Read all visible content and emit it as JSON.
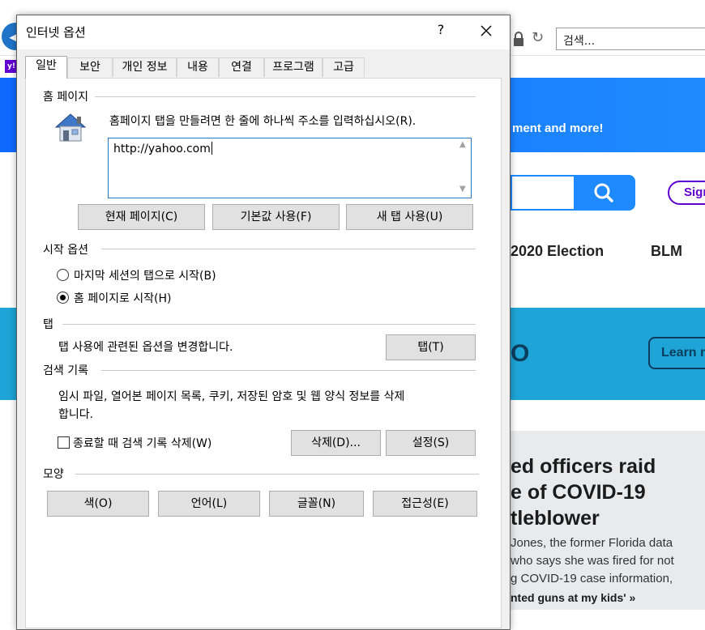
{
  "browser": {
    "search_placeholder": "검색...",
    "yahoo_favicon": "y!",
    "promo_text": "ment and more!",
    "signin_label": "Sign",
    "nav": [
      "2020 Election",
      "BLM"
    ],
    "teal_text": "O",
    "learn_label": "Learn m",
    "headline_lines": [
      "ed officers raid",
      "e of COVID-19",
      "tleblower"
    ],
    "summary_lines": [
      "Jones, the former Florida data",
      "who says she was fired for not",
      "g COVID-19 case information,"
    ],
    "quote": "nted guns at my kids' »",
    "colors": {
      "yahoo_purple": "#6001d2",
      "yahoo_blue": "#1d8bff",
      "teal": "#1ea4d6"
    }
  },
  "dialog": {
    "title": "인터넷 옵션",
    "help_label": "?",
    "tabs": [
      "일반",
      "보안",
      "개인 정보",
      "내용",
      "연결",
      "프로그램",
      "고급"
    ],
    "active_tab": 0,
    "home_page": {
      "label": "홈 페이지",
      "description": "홈페이지 탭을 만들려면 한 줄에 하나씩 주소를 입력하십시오(R).",
      "url_value": "http://yahoo.com",
      "buttons": [
        "현재 페이지(C)",
        "기본값 사용(F)",
        "새 탭 사용(U)"
      ]
    },
    "startup": {
      "label": "시작 옵션",
      "options": [
        {
          "label": "마지막 세션의 탭으로 시작(B)",
          "checked": false
        },
        {
          "label": "홈 페이지로 시작(H)",
          "checked": true
        }
      ]
    },
    "tabs_group": {
      "label": "탭",
      "description": "탭 사용에 관련된 옵션을 변경합니다.",
      "button": "탭(T)"
    },
    "history": {
      "label": "검색 기록",
      "description_lines": [
        "임시 파일, 열어본 페이지 목록, 쿠키, 저장된 암호 및 웹 양식 정보를 삭제",
        "합니다."
      ],
      "checkbox_label": "종료할 때 검색 기록 삭제(W)",
      "checkbox_checked": false,
      "delete_button": "삭제(D)...",
      "settings_button": "설정(S)"
    },
    "appearance": {
      "label": "모양",
      "buttons": [
        "색(O)",
        "언어(L)",
        "글꼴(N)",
        "접근성(E)"
      ]
    }
  }
}
